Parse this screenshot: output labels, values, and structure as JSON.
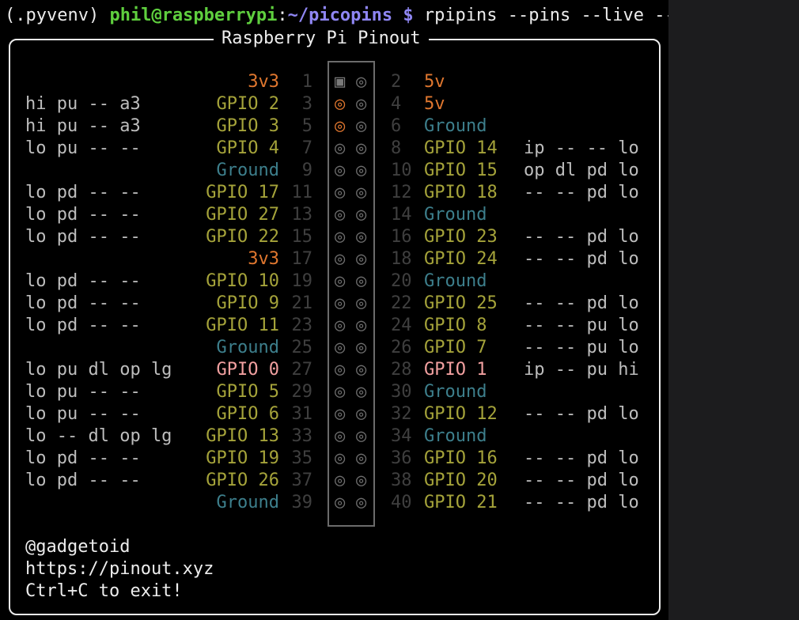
{
  "prompt": {
    "venv": "(.pyvenv) ",
    "user_host": "phil@raspberrypi",
    "colon": ":",
    "path": "~/picopins",
    "dollar": " $",
    "command": " rpipins --pins --live --debug"
  },
  "panel": {
    "title": "Raspberry Pi Pinout"
  },
  "pins": [
    {
      "left": {
        "status": "",
        "name": "3v3",
        "num": "1",
        "sym": "▣",
        "kind": "pwr",
        "symkind": "sq"
      },
      "right": {
        "status": "",
        "name": "5v",
        "num": "2",
        "sym": "◎",
        "kind": "pwr",
        "symkind": "pin"
      }
    },
    {
      "left": {
        "status": "hi pu -- a3",
        "name": "GPIO 2",
        "num": "3",
        "sym": "◎",
        "kind": "gpio",
        "symkind": "pwr"
      },
      "right": {
        "status": "",
        "name": "5v",
        "num": "4",
        "sym": "◎",
        "kind": "pwr",
        "symkind": "pin"
      }
    },
    {
      "left": {
        "status": "hi pu -- a3",
        "name": "GPIO 3",
        "num": "5",
        "sym": "◎",
        "kind": "gpio",
        "symkind": "pwr"
      },
      "right": {
        "status": "",
        "name": "Ground",
        "num": "6",
        "sym": "◎",
        "kind": "gnd",
        "symkind": "pin"
      }
    },
    {
      "left": {
        "status": "lo pu -- --",
        "name": "GPIO 4",
        "num": "7",
        "sym": "◎",
        "kind": "gpio",
        "symkind": "pin"
      },
      "right": {
        "status": "ip -- -- lo",
        "name": "GPIO 14",
        "num": "8",
        "sym": "◎",
        "kind": "gpio",
        "symkind": "pin"
      }
    },
    {
      "left": {
        "status": "",
        "name": "Ground",
        "num": "9",
        "sym": "◎",
        "kind": "gnd",
        "symkind": "pin"
      },
      "right": {
        "status": "op dl pd lo",
        "name": "GPIO 15",
        "num": "10",
        "sym": "◎",
        "kind": "gpio",
        "symkind": "pin"
      }
    },
    {
      "left": {
        "status": "lo pd -- --",
        "name": "GPIO 17",
        "num": "11",
        "sym": "◎",
        "kind": "gpio",
        "symkind": "pin"
      },
      "right": {
        "status": "-- -- pd lo",
        "name": "GPIO 18",
        "num": "12",
        "sym": "◎",
        "kind": "gpio",
        "symkind": "pin"
      }
    },
    {
      "left": {
        "status": "lo pd -- --",
        "name": "GPIO 27",
        "num": "13",
        "sym": "◎",
        "kind": "gpio",
        "symkind": "pin"
      },
      "right": {
        "status": "",
        "name": "Ground",
        "num": "14",
        "sym": "◎",
        "kind": "gnd",
        "symkind": "pin"
      }
    },
    {
      "left": {
        "status": "lo pd -- --",
        "name": "GPIO 22",
        "num": "15",
        "sym": "◎",
        "kind": "gpio",
        "symkind": "pin"
      },
      "right": {
        "status": "-- -- pd lo",
        "name": "GPIO 23",
        "num": "16",
        "sym": "◎",
        "kind": "gpio",
        "symkind": "pin"
      }
    },
    {
      "left": {
        "status": "",
        "name": "3v3",
        "num": "17",
        "sym": "◎",
        "kind": "pwr",
        "symkind": "pin"
      },
      "right": {
        "status": "-- -- pd lo",
        "name": "GPIO 24",
        "num": "18",
        "sym": "◎",
        "kind": "gpio",
        "symkind": "pin"
      }
    },
    {
      "left": {
        "status": "lo pd -- --",
        "name": "GPIO 10",
        "num": "19",
        "sym": "◎",
        "kind": "gpio",
        "symkind": "pin"
      },
      "right": {
        "status": "",
        "name": "Ground",
        "num": "20",
        "sym": "◎",
        "kind": "gnd",
        "symkind": "pin"
      }
    },
    {
      "left": {
        "status": "lo pd -- --",
        "name": "GPIO 9",
        "num": "21",
        "sym": "◎",
        "kind": "gpio",
        "symkind": "pin"
      },
      "right": {
        "status": "-- -- pd lo",
        "name": "GPIO 25",
        "num": "22",
        "sym": "◎",
        "kind": "gpio",
        "symkind": "pin"
      }
    },
    {
      "left": {
        "status": "lo pd -- --",
        "name": "GPIO 11",
        "num": "23",
        "sym": "◎",
        "kind": "gpio",
        "symkind": "pin"
      },
      "right": {
        "status": "-- -- pu lo",
        "name": "GPIO 8",
        "num": "24",
        "sym": "◎",
        "kind": "gpio",
        "symkind": "pin"
      }
    },
    {
      "left": {
        "status": "",
        "name": "Ground",
        "num": "25",
        "sym": "◎",
        "kind": "gnd",
        "symkind": "pin"
      },
      "right": {
        "status": "-- -- pu lo",
        "name": "GPIO 7",
        "num": "26",
        "sym": "◎",
        "kind": "gpio",
        "symkind": "pin"
      }
    },
    {
      "left": {
        "status": "lo pu dl op lg",
        "name": "GPIO 0",
        "num": "27",
        "sym": "◎",
        "kind": "alt",
        "symkind": "pin"
      },
      "right": {
        "status": "ip -- pu hi",
        "name": "GPIO 1",
        "num": "28",
        "sym": "◎",
        "kind": "alt",
        "symkind": "pin"
      }
    },
    {
      "left": {
        "status": "lo pu -- --",
        "name": "GPIO 5",
        "num": "29",
        "sym": "◎",
        "kind": "gpio",
        "symkind": "pin"
      },
      "right": {
        "status": "",
        "name": "Ground",
        "num": "30",
        "sym": "◎",
        "kind": "gnd",
        "symkind": "pin"
      }
    },
    {
      "left": {
        "status": "lo pu -- --",
        "name": "GPIO 6",
        "num": "31",
        "sym": "◎",
        "kind": "gpio",
        "symkind": "pin"
      },
      "right": {
        "status": "-- -- pd lo",
        "name": "GPIO 12",
        "num": "32",
        "sym": "◎",
        "kind": "gpio",
        "symkind": "pin"
      }
    },
    {
      "left": {
        "status": "lo -- dl op lg",
        "name": "GPIO 13",
        "num": "33",
        "sym": "◎",
        "kind": "gpio",
        "symkind": "pin"
      },
      "right": {
        "status": "",
        "name": "Ground",
        "num": "34",
        "sym": "◎",
        "kind": "gnd",
        "symkind": "pin"
      }
    },
    {
      "left": {
        "status": "lo pd -- --",
        "name": "GPIO 19",
        "num": "35",
        "sym": "◎",
        "kind": "gpio",
        "symkind": "pin"
      },
      "right": {
        "status": "-- -- pd lo",
        "name": "GPIO 16",
        "num": "36",
        "sym": "◎",
        "kind": "gpio",
        "symkind": "pin"
      }
    },
    {
      "left": {
        "status": "lo pd -- --",
        "name": "GPIO 26",
        "num": "37",
        "sym": "◎",
        "kind": "gpio",
        "symkind": "pin"
      },
      "right": {
        "status": "-- -- pd lo",
        "name": "GPIO 20",
        "num": "38",
        "sym": "◎",
        "kind": "gpio",
        "symkind": "pin"
      }
    },
    {
      "left": {
        "status": "",
        "name": "Ground",
        "num": "39",
        "sym": "◎",
        "kind": "gnd",
        "symkind": "pin"
      },
      "right": {
        "status": "-- -- pd lo",
        "name": "GPIO 21",
        "num": "40",
        "sym": "◎",
        "kind": "gpio",
        "symkind": "pin"
      }
    }
  ],
  "footer": {
    "handle": "@gadgetoid",
    "url": "https://pinout.xyz",
    "exit_hint": "Ctrl+C to exit!"
  },
  "colors": {
    "power": "#e0772f",
    "ground": "#3d7f8c",
    "gpio": "#a5a33a",
    "gpio_alt": "#f2a0a0",
    "prompt_user": "#5fcf3e",
    "prompt_path": "#8f86f3"
  }
}
